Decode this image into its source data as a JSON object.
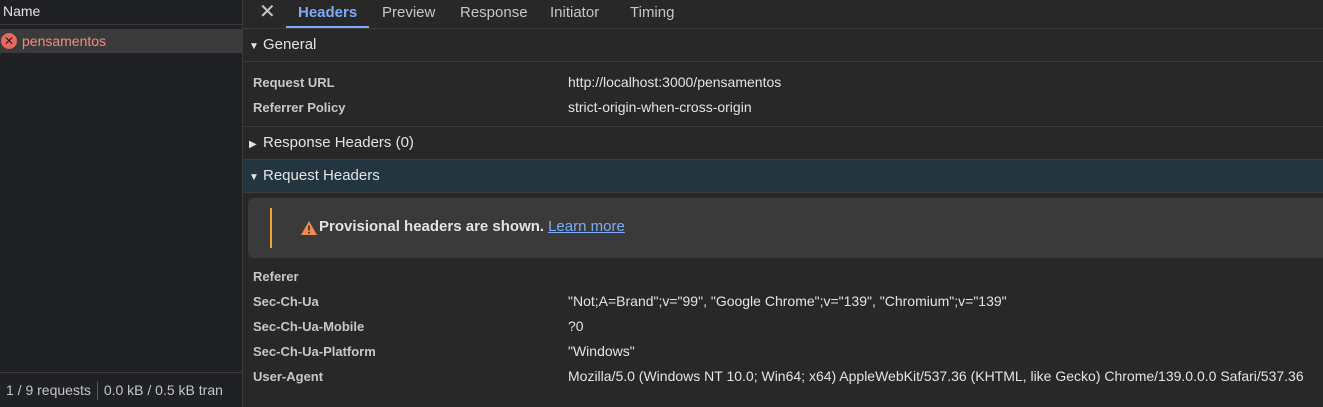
{
  "left_pane": {
    "column_header": "Name",
    "selected_request": "pensamentos",
    "footer": {
      "requests": "1 / 9 requests",
      "transferred": "0.0 kB / 0.5 kB tran"
    }
  },
  "tabs": [
    "Headers",
    "Preview",
    "Response",
    "Initiator",
    "Timing"
  ],
  "active_tab": "Headers",
  "sections": {
    "general": {
      "title": "General",
      "rows": [
        {
          "key": "Request URL",
          "value": "http://localhost:3000/pensamentos"
        },
        {
          "key": "Referrer Policy",
          "value": "strict-origin-when-cross-origin"
        }
      ]
    },
    "response_headers": {
      "title": "Response Headers (0)"
    },
    "request_headers": {
      "title": "Request Headers",
      "warning": "Provisional headers are shown.",
      "warning_link": "Learn more",
      "rows": [
        {
          "key": "Referer",
          "value": ""
        },
        {
          "key": "Sec-Ch-Ua",
          "value": "\"Not;A=Brand\";v=\"99\", \"Google Chrome\";v=\"139\", \"Chromium\";v=\"139\""
        },
        {
          "key": "Sec-Ch-Ua-Mobile",
          "value": "?0"
        },
        {
          "key": "Sec-Ch-Ua-Platform",
          "value": "\"Windows\""
        },
        {
          "key": "User-Agent",
          "value": "Mozilla/5.0 (Windows NT 10.0; Win64; x64) AppleWebKit/537.36 (KHTML, like Gecko) Chrome/139.0.0.0 Safari/537.36"
        }
      ]
    }
  },
  "colors": {
    "accent": "#7cacf8",
    "error": "#f28b82",
    "warning": "#f0a630"
  }
}
